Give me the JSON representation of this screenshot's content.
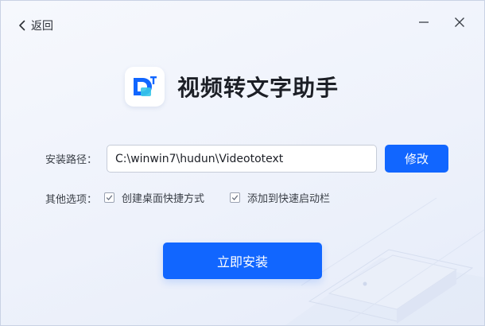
{
  "header": {
    "back_label": "返回",
    "minimize_icon": "minimize-icon",
    "close_icon": "close-icon"
  },
  "brand": {
    "logo_icon": "video-text-logo-icon",
    "title": "视频转文字助手",
    "accent_color": "#1166ff"
  },
  "install_path": {
    "label": "安装路径：",
    "value": "C:\\winwin7\\hudun\\Videototext",
    "modify_label": "修改"
  },
  "options": {
    "label": "其他选项：",
    "items": [
      {
        "label": "创建桌面快捷方式",
        "checked": true
      },
      {
        "label": "添加到快速启动栏",
        "checked": true
      }
    ]
  },
  "install_button": {
    "label": "立即安装"
  }
}
